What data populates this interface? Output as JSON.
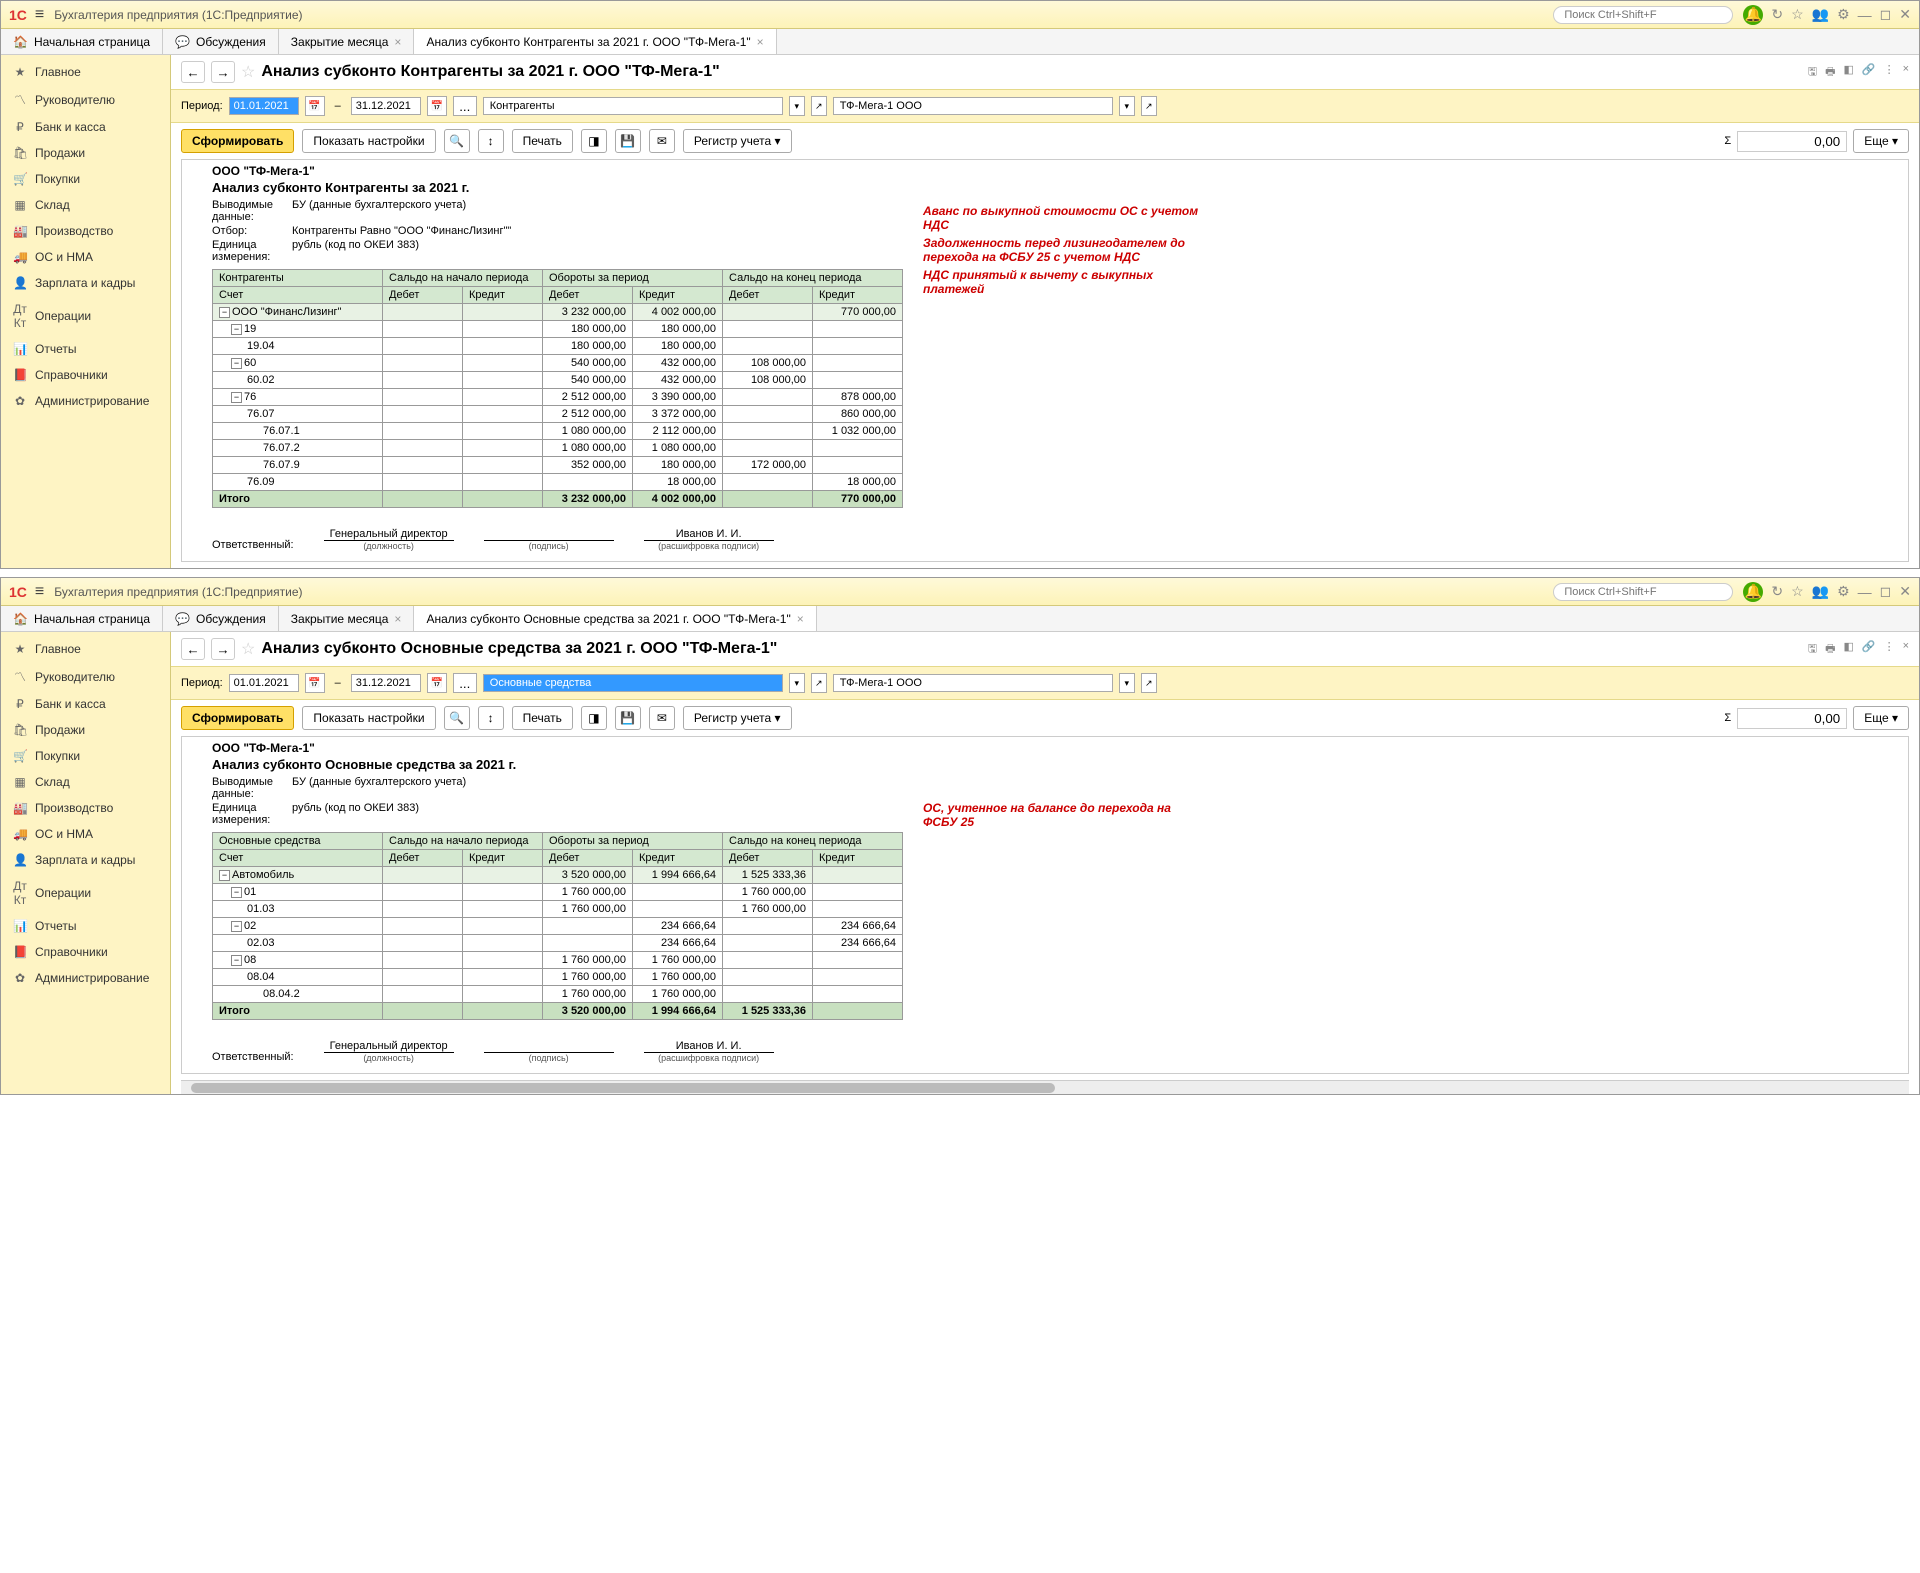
{
  "app": {
    "title": "Бухгалтерия предприятия  (1С:Предприятие)",
    "logo": "1C",
    "search_ph": "Поиск Ctrl+Shift+F"
  },
  "tabs_home": "Начальная страница",
  "tabs_disc": "Обсуждения",
  "tabs_month": "Закрытие месяца",
  "tabs_r1": "Анализ субконто Контрагенты за 2021 г. ООО \"ТФ-Мега-1\"",
  "tabs_r2": "Анализ субконто Основные средства за 2021 г. ООО \"ТФ-Мега-1\"",
  "sidebar": [
    "Главное",
    "Руководителю",
    "Банк и касса",
    "Продажи",
    "Покупки",
    "Склад",
    "Производство",
    "ОС и НМА",
    "Зарплата и кадры",
    "Операции",
    "Отчеты",
    "Справочники",
    "Администрирование"
  ],
  "side_icons": [
    "★",
    "〽",
    "₽",
    "🛍",
    "🛒",
    "▦",
    "🏭",
    "🚚",
    "👤",
    "Дт Кт",
    "📊",
    "📕",
    "✿"
  ],
  "page1_title": "Анализ субконто Контрагенты за 2021 г. ООО \"ТФ-Мега-1\"",
  "page2_title": "Анализ субконто Основные средства за 2021 г. ООО \"ТФ-Мега-1\"",
  "period_lbl": "Период:",
  "date_from": "01.01.2021",
  "date_to": "31.12.2021",
  "subconto1": "Контрагенты",
  "subconto2": "Основные средства",
  "org": "ТФ-Мега-1 ООО",
  "btn_form": "Сформировать",
  "btn_settings": "Показать настройки",
  "btn_print": "Печать",
  "btn_reg": "Регистр учета",
  "btn_more": "Еще",
  "sum_val": "0,00",
  "rpt_org": "ООО \"ТФ-Мега-1\"",
  "rpt1_title": "Анализ субконто Контрагенты за 2021 г.",
  "rpt2_title": "Анализ субконто Основные средства за 2021 г.",
  "meta_out_lbl": "Выводимые данные:",
  "meta_out_val": "БУ (данные бухгалтерского учета)",
  "meta_filter_lbl": "Отбор:",
  "meta_filter_val": "Контрагенты Равно \"ООО \"ФинансЛизинг\"\"",
  "meta_unit_lbl": "Единица измерения:",
  "meta_unit_val": "рубль (код по ОКЕИ 383)",
  "hdr_subj1": "Контрагенты",
  "hdr_subj2": "Основные средства",
  "hdr_acc": "Счет",
  "hdr_start": "Сальдо на начало периода",
  "hdr_turn": "Обороты за период",
  "hdr_end": "Сальдо на конец периода",
  "hdr_dt": "Дебет",
  "hdr_kt": "Кредит",
  "r1_name": "ООО \"ФинансЛизинг\"",
  "r1_rows": [
    {
      "acc": "",
      "name": "ООО \"ФинансЛизинг\"",
      "dt": "3 232 000,00",
      "kt": "4 002 000,00",
      "edt": "",
      "ekt": "770 000,00",
      "lvl": 0
    },
    {
      "acc": "19",
      "dt": "180 000,00",
      "kt": "180 000,00",
      "edt": "",
      "ekt": "",
      "lvl": 1
    },
    {
      "acc": "19.04",
      "dt": "180 000,00",
      "kt": "180 000,00",
      "edt": "",
      "ekt": "",
      "lvl": 2
    },
    {
      "acc": "60",
      "dt": "540 000,00",
      "kt": "432 000,00",
      "edt": "108 000,00",
      "ekt": "",
      "lvl": 1
    },
    {
      "acc": "60.02",
      "dt": "540 000,00",
      "kt": "432 000,00",
      "edt": "108 000,00",
      "ekt": "",
      "lvl": 2
    },
    {
      "acc": "76",
      "dt": "2 512 000,00",
      "kt": "3 390 000,00",
      "edt": "",
      "ekt": "878 000,00",
      "lvl": 1
    },
    {
      "acc": "76.07",
      "dt": "2 512 000,00",
      "kt": "3 372 000,00",
      "edt": "",
      "ekt": "860 000,00",
      "lvl": 2
    },
    {
      "acc": "76.07.1",
      "dt": "1 080 000,00",
      "kt": "2 112 000,00",
      "edt": "",
      "ekt": "1 032 000,00",
      "lvl": 3
    },
    {
      "acc": "76.07.2",
      "dt": "1 080 000,00",
      "kt": "1 080 000,00",
      "edt": "",
      "ekt": "",
      "lvl": 3
    },
    {
      "acc": "76.07.9",
      "dt": "352 000,00",
      "kt": "180 000,00",
      "edt": "172 000,00",
      "ekt": "",
      "lvl": 3
    },
    {
      "acc": "76.09",
      "dt": "",
      "kt": "18 000,00",
      "edt": "",
      "ekt": "18 000,00",
      "lvl": 2
    }
  ],
  "r1_total": {
    "lbl": "Итого",
    "dt": "3 232 000,00",
    "kt": "4 002 000,00",
    "edt": "",
    "ekt": "770 000,00"
  },
  "r2_rows": [
    {
      "acc": "",
      "name": "Автомобиль",
      "dt": "3 520 000,00",
      "kt": "1 994 666,64",
      "edt": "1 525 333,36",
      "ekt": "",
      "lvl": 0
    },
    {
      "acc": "01",
      "dt": "1 760 000,00",
      "kt": "",
      "edt": "1 760 000,00",
      "ekt": "",
      "lvl": 1
    },
    {
      "acc": "01.03",
      "dt": "1 760 000,00",
      "kt": "",
      "edt": "1 760 000,00",
      "ekt": "",
      "lvl": 2
    },
    {
      "acc": "02",
      "dt": "",
      "kt": "234 666,64",
      "edt": "",
      "ekt": "234 666,64",
      "lvl": 1
    },
    {
      "acc": "02.03",
      "dt": "",
      "kt": "234 666,64",
      "edt": "",
      "ekt": "234 666,64",
      "lvl": 2
    },
    {
      "acc": "08",
      "dt": "1 760 000,00",
      "kt": "1 760 000,00",
      "edt": "",
      "ekt": "",
      "lvl": 1
    },
    {
      "acc": "08.04",
      "dt": "1 760 000,00",
      "kt": "1 760 000,00",
      "edt": "",
      "ekt": "",
      "lvl": 2
    },
    {
      "acc": "08.04.2",
      "dt": "1 760 000,00",
      "kt": "1 760 000,00",
      "edt": "",
      "ekt": "",
      "lvl": 3
    }
  ],
  "r2_total": {
    "lbl": "Итого",
    "dt": "3 520 000,00",
    "kt": "1 994 666,64",
    "edt": "1 525 333,36",
    "ekt": ""
  },
  "sig_lbl": "Ответственный:",
  "sig_pos": "Генеральный директор",
  "sig_pos_cap": "(должность)",
  "sig_sign_cap": "(подпись)",
  "sig_name": "Иванов И. И.",
  "sig_name_cap": "(расшифровка подписи)",
  "ann1": "Аванс по выкупной стоимости ОС с учетом НДС",
  "ann2": "Задолженность перед лизингодателем до перехода на ФСБУ 25 с учетом НДС",
  "ann3": "НДС принятый к вычету с выкупных платежей",
  "ann4": "ОС, учтенное на балансе до перехода на ФСБУ 25"
}
